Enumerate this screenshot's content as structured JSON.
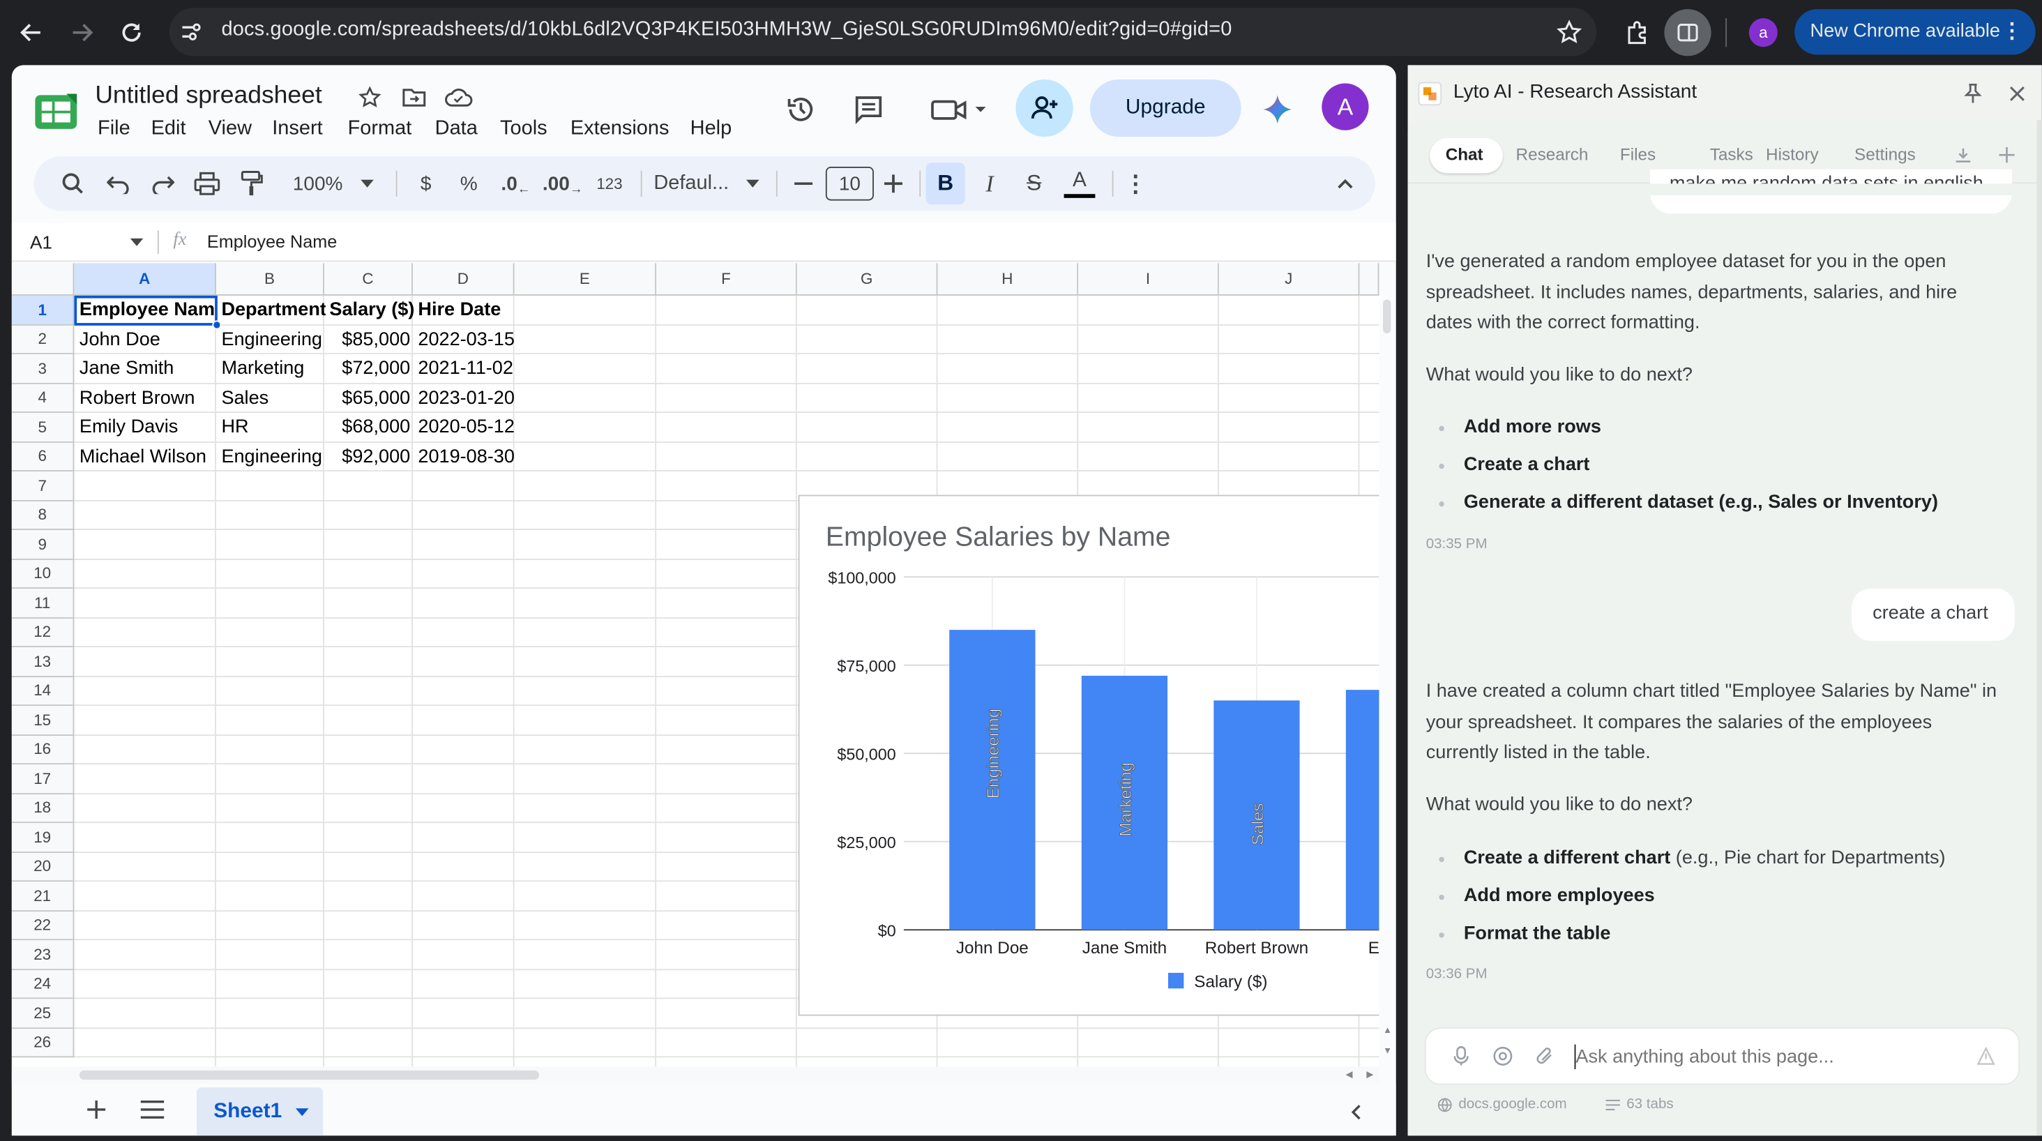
{
  "browser": {
    "url": "docs.google.com/spreadsheets/d/10kbL6dl2VQ3P4KEI503HMH3W_GjeS0LSG0RUDIm96M0/edit?gid=0#gid=0",
    "profile_initial": "a",
    "update_label": "New Chrome available"
  },
  "sheets": {
    "title": "Untitled spreadsheet",
    "menu": [
      "File",
      "Edit",
      "View",
      "Insert",
      "Format",
      "Data",
      "Tools",
      "Extensions",
      "Help"
    ],
    "upgrade_label": "Upgrade",
    "avatar_initial": "A",
    "toolbar": {
      "zoom": "100%",
      "currency": "$",
      "percent": "%",
      "dec_less": ".0",
      "dec_more": ".00",
      "number_format": "123",
      "font": "Defaul...",
      "font_size": "10"
    },
    "cell_ref": "A1",
    "formula_value": "Employee Name",
    "columns": [
      "A",
      "B",
      "C",
      "D",
      "E",
      "F",
      "G",
      "H",
      "I",
      "J"
    ],
    "row_numbers": [
      "1",
      "2",
      "3",
      "4",
      "5",
      "6",
      "7",
      "8",
      "9",
      "10",
      "11",
      "12",
      "13",
      "14",
      "15",
      "16",
      "17",
      "18",
      "19",
      "20",
      "21",
      "22",
      "23",
      "24",
      "25",
      "26"
    ],
    "rows": [
      [
        "Employee Name",
        "Department",
        "Salary ($)",
        "Hire Date"
      ],
      [
        "John Doe",
        "Engineering",
        "$85,000",
        "2022-03-15"
      ],
      [
        "Jane Smith",
        "Marketing",
        "$72,000",
        "2021-11-02"
      ],
      [
        "Robert Brown",
        "Sales",
        "$65,000",
        "2023-01-20"
      ],
      [
        "Emily Davis",
        "HR",
        "$68,000",
        "2020-05-12"
      ],
      [
        "Michael Wilson",
        "Engineering",
        "$92,000",
        "2019-08-30"
      ]
    ],
    "sheet_tab": "Sheet1"
  },
  "chart_data": {
    "type": "bar",
    "title": "Employee Salaries by Name",
    "categories": [
      "John Doe",
      "Jane Smith",
      "Robert Brown",
      "Emily"
    ],
    "series": [
      {
        "name": "Salary ($)",
        "values": [
          85000,
          72000,
          65000,
          68000
        ],
        "color": "#4285f4"
      }
    ],
    "bar_labels": [
      "Engineering",
      "Marketing",
      "Sales",
      ""
    ],
    "yticks": [
      "$0",
      "$25,000",
      "$50,000",
      "$75,000",
      "$100,000"
    ],
    "ylim": [
      0,
      100000
    ],
    "grid": true,
    "legend": "bottom"
  },
  "sidebar": {
    "title": "Lyto AI - Research Assistant",
    "tabs": [
      "Chat",
      "Research",
      "Files",
      "Tasks",
      "History",
      "Settings"
    ],
    "prev_user_msg": "make me random data sets in english",
    "msg1": "I've generated a random employee dataset for you in the open spreadsheet. It includes names, departments, salaries, and hire dates with the correct formatting.",
    "msg1_q": "What would you like to do next?",
    "msg1_bullets": [
      "Add more rows",
      "Create a chart",
      "Generate a different dataset (e.g., Sales or Inventory)"
    ],
    "ts1": "03:35 PM",
    "user_msg": "create a chart",
    "msg2": "I have created a column chart titled \"Employee Salaries by Name\" in your spreadsheet. It compares the salaries of the employees currently listed in the table.",
    "msg2_q": "What would you like to do next?",
    "msg2_b1_bold": "Create a different chart",
    "msg2_b1_rest": " (e.g., Pie chart for Departments)",
    "msg2_bullets": [
      "Add more employees",
      "Format the table"
    ],
    "ts2": "03:36 PM",
    "input_placeholder": "Ask anything about this page...",
    "footer_domain": "docs.google.com",
    "footer_tabs": "63 tabs"
  },
  "colors": {
    "accent": "#0b57d0",
    "bar": "#4285f4",
    "upgrade_bg": "#d3e3fd",
    "avatar": "#8430ce"
  }
}
